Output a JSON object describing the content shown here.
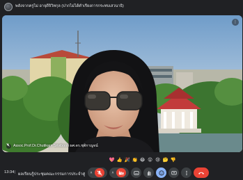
{
  "window": {
    "title": "พลังจากครูไม่ อาจุดีจิวิทกุล (ปากไม่ได้ตำเรียงการกระทบเสวนาธิ)"
  },
  "video": {
    "participant_name": "Assoc.Prof.Dr.Chutikarn Sriviboon ผศ.ดร.ชุติกาญจน์",
    "menu_glyph": "⋮",
    "mic_state": "muted-icon"
  },
  "reactions": [
    {
      "glyph": "💖",
      "icon": "sparkling-heart-icon"
    },
    {
      "glyph": "👍",
      "icon": "thumbs-up-icon"
    },
    {
      "glyph": "🎉",
      "icon": "party-popper-icon"
    },
    {
      "glyph": "👏",
      "icon": "clapping-hands-icon"
    },
    {
      "glyph": "😂",
      "icon": "tears-of-joy-icon"
    },
    {
      "glyph": "😮",
      "icon": "surprised-face-icon"
    },
    {
      "glyph": "😢",
      "icon": "crying-face-icon"
    },
    {
      "glyph": "🤔",
      "icon": "thinking-face-icon"
    },
    {
      "glyph": "👎",
      "icon": "thumbs-down-icon"
    }
  ],
  "bottom_bar": {
    "time": "13:34",
    "separator": "|",
    "meeting_title": "ผลเรียนรู้ประชุมคณะกรรมการประจำศูนย์การ...",
    "controls": [
      {
        "name": "microphone-toggle",
        "state": "off",
        "color": "#ea4335"
      },
      {
        "name": "camera-toggle",
        "state": "off",
        "color": "#ea4335"
      },
      {
        "name": "captions",
        "state": "default"
      },
      {
        "name": "raise-hand",
        "state": "default"
      },
      {
        "name": "emoji-reactions",
        "state": "active",
        "color": "#8ab4f8"
      },
      {
        "name": "present-screen",
        "state": "default"
      },
      {
        "name": "more-options",
        "state": "default"
      },
      {
        "name": "leave-call",
        "state": "default",
        "color": "#ea4335"
      }
    ]
  },
  "colors": {
    "background": "#202124",
    "control": "#3c4043",
    "danger": "#ea4335",
    "accent": "#8ab4f8"
  }
}
